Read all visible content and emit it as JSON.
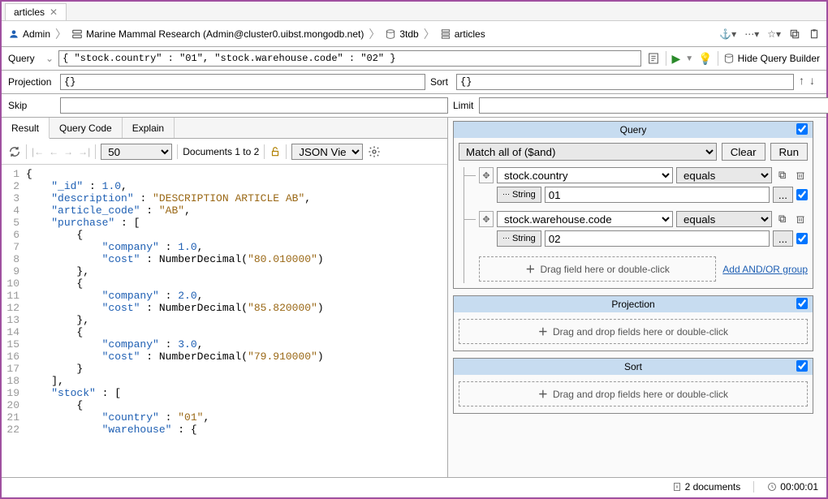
{
  "tab": {
    "title": "articles"
  },
  "breadcrumb": {
    "user": "Admin",
    "connection": "Marine Mammal Research (Admin@cluster0.uibst.mongodb.net)",
    "db": "3tdb",
    "coll": "articles"
  },
  "queryBar": {
    "label": "Query",
    "value": "{ \"stock.country\" : \"01\", \"stock.warehouse.code\" : \"02\" }",
    "hide_qb": "Hide Query Builder"
  },
  "fields": {
    "projection_label": "Projection",
    "projection_value": "{}",
    "sort_label": "Sort",
    "sort_value": "{}",
    "skip_label": "Skip",
    "skip_value": "",
    "limit_label": "Limit",
    "limit_value": ""
  },
  "resultTabs": {
    "result": "Result",
    "query_code": "Query Code",
    "explain": "Explain"
  },
  "resultToolbar": {
    "page_size": "50",
    "docs_label": "Documents 1 to 2",
    "view": "JSON View"
  },
  "jsonLines": [
    "{",
    "    \"_id\" : 1.0,",
    "    \"description\" : \"DESCRIPTION ARTICLE AB\",",
    "    \"article_code\" : \"AB\",",
    "    \"purchase\" : [",
    "        {",
    "            \"company\" : 1.0,",
    "            \"cost\" : NumberDecimal(\"80.010000\")",
    "        },",
    "        {",
    "            \"company\" : 2.0,",
    "            \"cost\" : NumberDecimal(\"85.820000\")",
    "        },",
    "        {",
    "            \"company\" : 3.0,",
    "            \"cost\" : NumberDecimal(\"79.910000\")",
    "        }",
    "    ],",
    "    \"stock\" : [",
    "        {",
    "            \"country\" : \"01\",",
    "            \"warehouse\" : {"
  ],
  "queryPanel": {
    "title": "Query",
    "match": "Match all of ($and)",
    "clear": "Clear",
    "run": "Run",
    "cond1_field": "stock.country",
    "cond1_op": "equals",
    "cond1_type": "String",
    "cond1_val": "01",
    "cond2_field": "stock.warehouse.code",
    "cond2_op": "equals",
    "cond2_type": "String",
    "cond2_val": "02",
    "drop_hint": "Drag field here or double-click",
    "add_group": "Add AND/OR group"
  },
  "projPanel": {
    "title": "Projection",
    "hint": "Drag and drop fields here or double-click"
  },
  "sortPanel": {
    "title": "Sort",
    "hint": "Drag and drop fields here or double-click"
  },
  "status": {
    "doc_count": "2 documents",
    "time": "00:00:01"
  }
}
